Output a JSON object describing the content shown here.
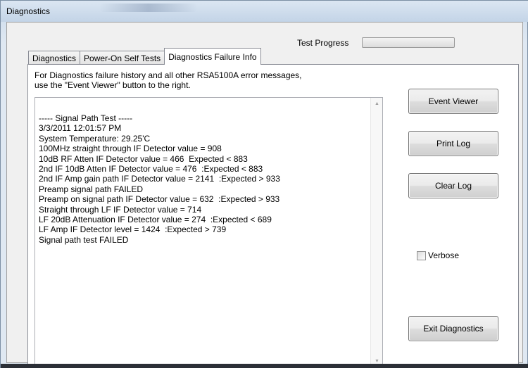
{
  "window": {
    "title": "Diagnostics"
  },
  "progress": {
    "label": "Test Progress",
    "value_percent": 0
  },
  "tabs": [
    {
      "label": "Diagnostics",
      "active": false
    },
    {
      "label": "Power-On Self Tests",
      "active": false
    },
    {
      "label": "Diagnostics Failure Info",
      "active": true
    }
  ],
  "info": {
    "line1": "For Diagnostics failure history and all other RSA5100A  error messages,",
    "line2": "use the \"Event Viewer\" button to the right."
  },
  "log": {
    "lines": [
      "----- Signal Path Test -----",
      "3/3/2011 12:01:57 PM",
      "System Temperature: 29.25'C",
      "100MHz straight through IF Detector value = 908",
      "10dB RF Atten IF Detector value = 466  Expected < 883",
      "2nd IF 10dB Atten IF Detector value = 476  :Expected < 883",
      "2nd IF Amp gain path IF Detector value = 2141  :Expected > 933",
      "Preamp signal path FAILED",
      "Preamp on signal path IF Detector value = 632  :Expected > 933",
      "Straight through LF IF Detector value = 714",
      "LF 20dB Attenuation IF Detector value = 274  :Expected < 689",
      "LF Amp IF Detector level = 1424  :Expected > 739",
      "Signal path test FAILED"
    ]
  },
  "buttons": {
    "event_viewer": "Event Viewer",
    "print_log": "Print Log",
    "clear_log": "Clear Log",
    "exit": "Exit Diagnostics"
  },
  "verbose": {
    "label": "Verbose",
    "checked": false
  },
  "colors": {
    "window_chrome": "#dfe8f2",
    "panel": "#f0f0f0",
    "progress_fill": "#5fbf5f"
  }
}
